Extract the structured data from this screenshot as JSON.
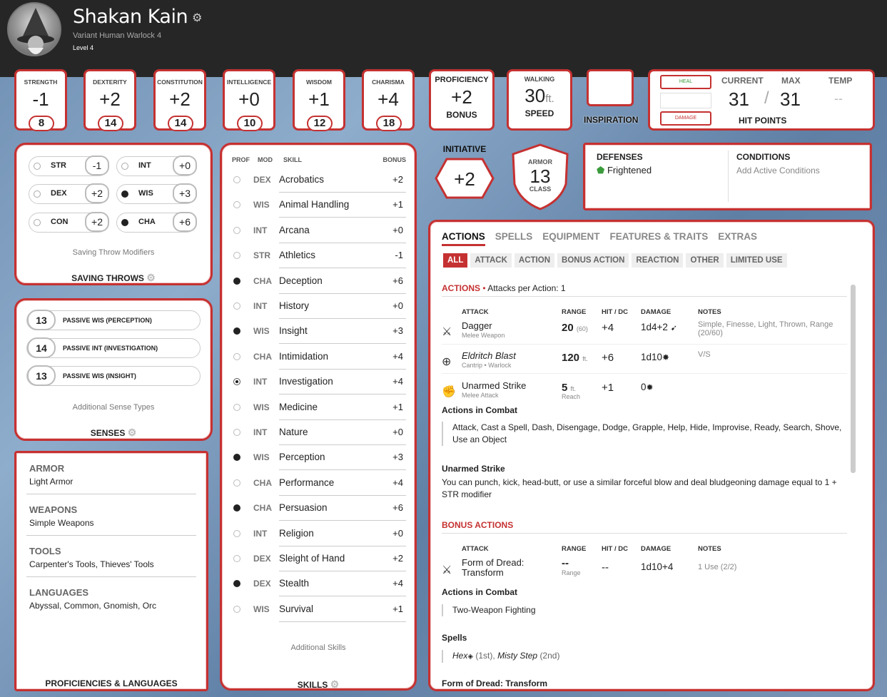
{
  "header": {
    "name": "Shakan Kain",
    "subtitle": "Variant Human  Warlock 4",
    "level": "Level 4"
  },
  "abilities": [
    {
      "label": "STRENGTH",
      "mod": "-1",
      "score": "8"
    },
    {
      "label": "DEXTERITY",
      "mod": "+2",
      "score": "14"
    },
    {
      "label": "CONSTITUTION",
      "mod": "+2",
      "score": "14"
    },
    {
      "label": "INTELLIGENCE",
      "mod": "+0",
      "score": "10"
    },
    {
      "label": "WISDOM",
      "mod": "+1",
      "score": "12"
    },
    {
      "label": "CHARISMA",
      "mod": "+4",
      "score": "18"
    }
  ],
  "proficiency": {
    "title": "PROFICIENCY",
    "value": "+2",
    "bottom": "BONUS"
  },
  "speed": {
    "title": "WALKING",
    "value": "30",
    "unit": "ft.",
    "bottom": "SPEED"
  },
  "inspiration": {
    "label": "INSPIRATION"
  },
  "hp": {
    "heal": "HEAL",
    "damage": "DAMAGE",
    "current_label": "CURRENT",
    "max_label": "MAX",
    "temp_label": "TEMP",
    "current": "31",
    "slash": "/",
    "max": "31",
    "temp": "--",
    "bottom": "HIT POINTS"
  },
  "initiative": {
    "label": "INITIATIVE",
    "value": "+2"
  },
  "armor": {
    "top": "ARMOR",
    "value": "13",
    "bottom": "CLASS"
  },
  "defenses": {
    "title": "DEFENSES",
    "item": "Frightened"
  },
  "conditions": {
    "title": "CONDITIONS",
    "placeholder": "Add Active Conditions"
  },
  "saves": {
    "items": [
      {
        "ab": "STR",
        "bonus": "-1",
        "prof": false
      },
      {
        "ab": "INT",
        "bonus": "+0",
        "prof": false
      },
      {
        "ab": "DEX",
        "bonus": "+2",
        "prof": false
      },
      {
        "ab": "WIS",
        "bonus": "+3",
        "prof": true
      },
      {
        "ab": "CON",
        "bonus": "+2",
        "prof": false
      },
      {
        "ab": "CHA",
        "bonus": "+6",
        "prof": true
      }
    ],
    "sub": "Saving Throw Modifiers",
    "title": "SAVING THROWS"
  },
  "senses": {
    "items": [
      {
        "n": "13",
        "t": "PASSIVE WIS (PERCEPTION)"
      },
      {
        "n": "14",
        "t": "PASSIVE INT (INVESTIGATION)"
      },
      {
        "n": "13",
        "t": "PASSIVE WIS (INSIGHT)"
      }
    ],
    "sub": "Additional Sense Types",
    "title": "SENSES"
  },
  "proficiencies": {
    "items": [
      {
        "h": "ARMOR",
        "v": "Light Armor"
      },
      {
        "h": "WEAPONS",
        "v": "Simple Weapons"
      },
      {
        "h": "TOOLS",
        "v": "Carpenter's Tools, Thieves' Tools"
      },
      {
        "h": "LANGUAGES",
        "v": "Abyssal, Common, Gnomish, Orc"
      }
    ],
    "title": "PROFICIENCIES & LANGUAGES"
  },
  "skills": {
    "headers": {
      "prof": "PROF",
      "mod": "MOD",
      "skill": "SKILL",
      "bonus": "BONUS"
    },
    "items": [
      {
        "p": "n",
        "m": "DEX",
        "s": "Acrobatics",
        "b": "+2"
      },
      {
        "p": "n",
        "m": "WIS",
        "s": "Animal Handling",
        "b": "+1"
      },
      {
        "p": "n",
        "m": "INT",
        "s": "Arcana",
        "b": "+0"
      },
      {
        "p": "n",
        "m": "STR",
        "s": "Athletics",
        "b": "-1"
      },
      {
        "p": "f",
        "m": "CHA",
        "s": "Deception",
        "b": "+6"
      },
      {
        "p": "n",
        "m": "INT",
        "s": "History",
        "b": "+0"
      },
      {
        "p": "f",
        "m": "WIS",
        "s": "Insight",
        "b": "+3"
      },
      {
        "p": "n",
        "m": "CHA",
        "s": "Intimidation",
        "b": "+4"
      },
      {
        "p": "e",
        "m": "INT",
        "s": "Investigation",
        "b": "+4"
      },
      {
        "p": "n",
        "m": "WIS",
        "s": "Medicine",
        "b": "+1"
      },
      {
        "p": "n",
        "m": "INT",
        "s": "Nature",
        "b": "+0"
      },
      {
        "p": "f",
        "m": "WIS",
        "s": "Perception",
        "b": "+3"
      },
      {
        "p": "n",
        "m": "CHA",
        "s": "Performance",
        "b": "+4"
      },
      {
        "p": "f",
        "m": "CHA",
        "s": "Persuasion",
        "b": "+6"
      },
      {
        "p": "n",
        "m": "INT",
        "s": "Religion",
        "b": "+0"
      },
      {
        "p": "n",
        "m": "DEX",
        "s": "Sleight of Hand",
        "b": "+2"
      },
      {
        "p": "f",
        "m": "DEX",
        "s": "Stealth",
        "b": "+4"
      },
      {
        "p": "n",
        "m": "WIS",
        "s": "Survival",
        "b": "+1"
      }
    ],
    "sub": "Additional Skills",
    "title": "SKILLS"
  },
  "actions": {
    "tabs": [
      "ACTIONS",
      "SPELLS",
      "EQUIPMENT",
      "FEATURES & TRAITS",
      "EXTRAS"
    ],
    "filters": [
      "ALL",
      "ATTACK",
      "ACTION",
      "BONUS ACTION",
      "REACTION",
      "OTHER",
      "LIMITED USE"
    ],
    "actions_h": "ACTIONS",
    "actions_sep": " • ",
    "actions_per": "Attacks per Action: 1",
    "cols": {
      "attack": "ATTACK",
      "range": "RANGE",
      "hit": "HIT / DC",
      "damage": "DAMAGE",
      "notes": "NOTES"
    },
    "attacks": [
      {
        "name": "Dagger",
        "sub": "Melee Weapon",
        "range": "20",
        "range_s": "(60)",
        "hit": "+4",
        "dmg": "1d4+2",
        "notes": "Simple, Finesse, Light, Thrown, Range (20/60)"
      },
      {
        "name": "Eldritch Blast",
        "sub": "Cantrip • Warlock",
        "range": "120",
        "range_s": "ft.",
        "hit": "+6",
        "dmg": "1d10",
        "notes": "V/S"
      },
      {
        "name": "Unarmed Strike",
        "sub": "Melee Attack",
        "range": "5",
        "range_s": "ft.",
        "range_b": "Reach",
        "hit": "+1",
        "dmg": "0",
        "notes": ""
      }
    ],
    "combat_h": "Actions in Combat",
    "combat_t": "Attack, Cast a Spell, Dash, Disengage, Dodge, Grapple, Help, Hide, Improvise, Ready, Search, Shove, Use an Object",
    "unarmed_h": "Unarmed Strike",
    "unarmed_t": "You can punch, kick, head-butt, or use a similar forceful blow and deal bludgeoning damage equal to 1 + STR modifier",
    "bonus_h": "BONUS ACTIONS",
    "bonus_attack": {
      "name": "Form of Dread:",
      "name2": "Transform",
      "range": "--",
      "range_b": "Range",
      "hit": "--",
      "dmg": "1d10+4",
      "notes": "1 Use (2/2)"
    },
    "bonus_combat_h": "Actions in Combat",
    "bonus_combat_t": "Two-Weapon Fighting",
    "spells_h": "Spells",
    "spell1": "Hex",
    "spell1_lvl": "(1st),",
    "spell2": "Misty Step",
    "spell2_lvl": "(2nd)",
    "cut_h": "Form of Dread: Transform"
  },
  "colors": {
    "accent": "#c53131",
    "header_bg": "#262626",
    "defense_icon": "#3a9b3a"
  }
}
